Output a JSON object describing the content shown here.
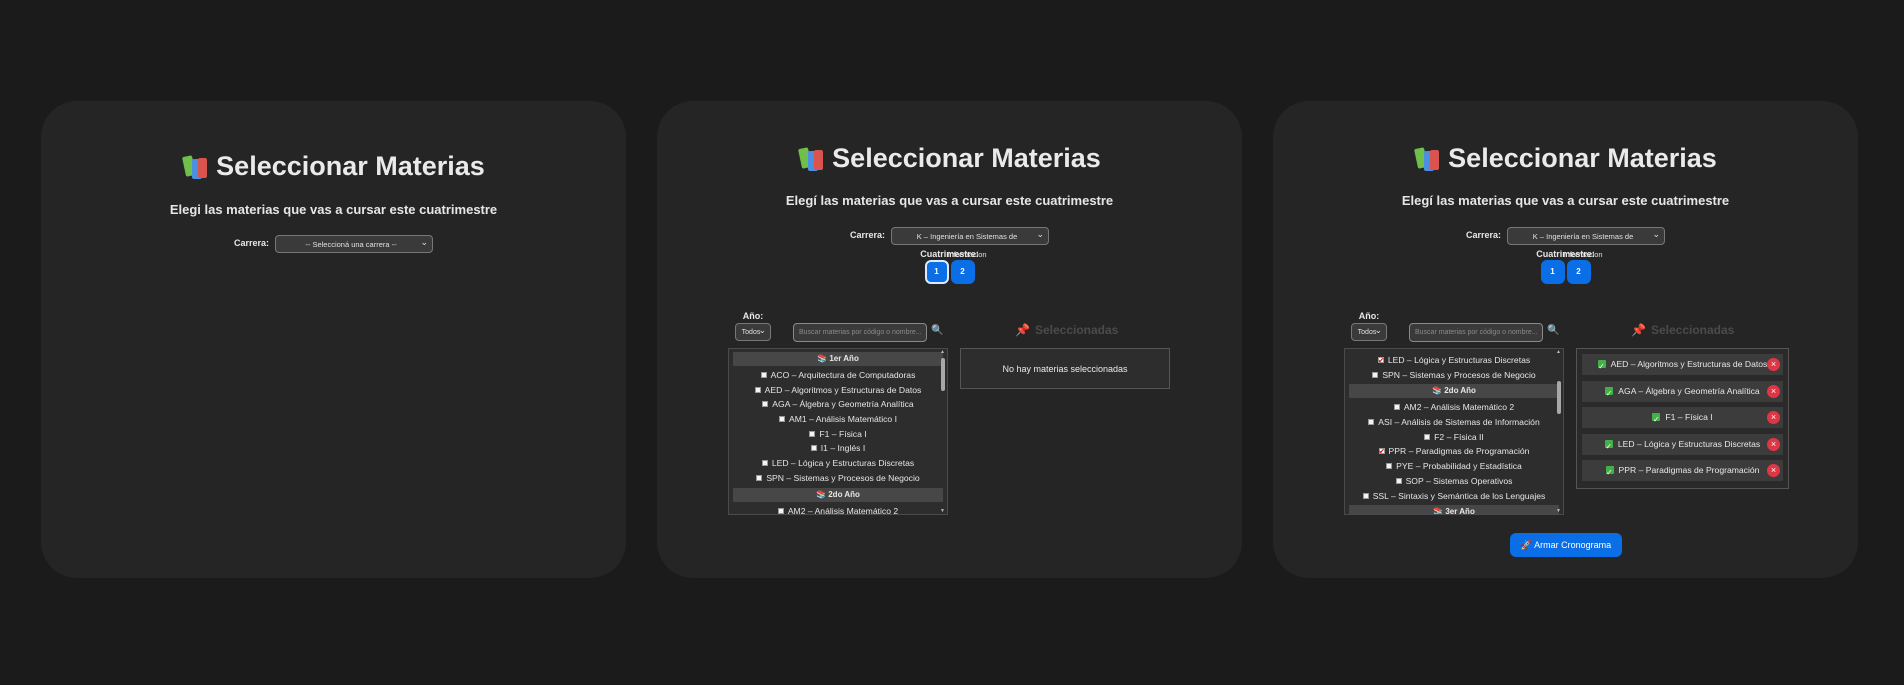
{
  "title": "Seleccionar Materias",
  "subtitle": "Elegí las materias que vas a cursar este cuatrimestre",
  "subtitle_panel1": "Elegi las materias que vas a cursar este cuatrimestre",
  "carrera_label": "Carrera:",
  "carrera_placeholder": "-- Seleccioná una carrera --",
  "carrera_selected": "K – Ingeniería en Sistemas de Informacion",
  "cuatrimestre_label": "Cuatrimestre:",
  "cuatrimestres": [
    "1",
    "2"
  ],
  "anio_label": "Año:",
  "anio_value": "Todos",
  "search_placeholder": "Buscar materias por código o nombre...",
  "seleccionadas_title": "Seleccionadas",
  "empty_text": "No hay materias seleccionadas",
  "armar_label": "Armar Cronograma",
  "panel2_list": [
    {
      "type": "header",
      "text": "1er Año"
    },
    {
      "type": "item",
      "text": "ACO – Arquitectura de Computadoras",
      "checked": false
    },
    {
      "type": "item",
      "text": "AED – Algoritmos y Estructuras de Datos",
      "checked": false
    },
    {
      "type": "item",
      "text": "AGA – Álgebra y Geometría Analítica",
      "checked": false
    },
    {
      "type": "item",
      "text": "AM1 – Análisis Matemático I",
      "checked": false
    },
    {
      "type": "item",
      "text": "F1 – Física I",
      "checked": false
    },
    {
      "type": "item",
      "text": "I1 – Inglés I",
      "checked": false
    },
    {
      "type": "item",
      "text": "LED – Lógica y Estructuras Discretas",
      "checked": false
    },
    {
      "type": "item",
      "text": "SPN – Sistemas y Procesos de Negocio",
      "checked": false
    },
    {
      "type": "header",
      "text": "2do Año"
    },
    {
      "type": "item",
      "text": "AM2 – Análisis Matemático 2",
      "checked": false
    }
  ],
  "panel3_list": [
    {
      "type": "item",
      "text": "LED – Lógica y Estructuras Discretas",
      "checked": true
    },
    {
      "type": "item",
      "text": "SPN – Sistemas y Procesos de Negocio",
      "checked": false
    },
    {
      "type": "header",
      "text": "2do Año"
    },
    {
      "type": "item",
      "text": "AM2 – Análisis Matemático 2",
      "checked": false
    },
    {
      "type": "item",
      "text": "ASI – Análisis de Sistemas de Información",
      "checked": false
    },
    {
      "type": "item",
      "text": "F2 – Física II",
      "checked": false
    },
    {
      "type": "item",
      "text": "PPR – Paradigmas de Programación",
      "checked": true
    },
    {
      "type": "item",
      "text": "PYE – Probabilidad y Estadística",
      "checked": false
    },
    {
      "type": "item",
      "text": "SOP – Sistemas Operativos",
      "checked": false
    },
    {
      "type": "item",
      "text": "SSL – Sintaxis y Semántica de los Lenguajes",
      "checked": false
    },
    {
      "type": "header",
      "text": "3er Año"
    }
  ],
  "selected": [
    "AED – Algoritmos y Estructuras de Datos",
    "AGA – Álgebra y Geometría Analítica",
    "F1 – Física I",
    "LED – Lógica y Estructuras Discretas",
    "PPR – Paradigmas de Programación"
  ],
  "scroll": {
    "panel2": 0.0,
    "panel3": 0.18
  },
  "colors": {
    "accent": "#0a6ee6",
    "remove": "#e03545",
    "check": "#43b049"
  }
}
